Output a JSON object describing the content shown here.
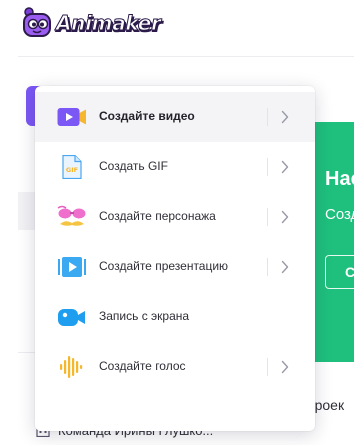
{
  "header": {
    "logo_text": "Animaker"
  },
  "promo": {
    "title": "Нас",
    "subtitle": "Созд",
    "button_label": "С"
  },
  "sidebar": {
    "team_label": "Команда Ирины Глушко..."
  },
  "main": {
    "projects_text": "проек"
  },
  "menu": {
    "items": [
      {
        "label": "Создайте видео",
        "icon": "video-icon",
        "has_submenu": true,
        "active": true
      },
      {
        "label": "Создать GIF",
        "icon": "gif-file-icon",
        "has_submenu": true,
        "active": false
      },
      {
        "label": "Создайте персонажа",
        "icon": "character-icon",
        "has_submenu": true,
        "active": false
      },
      {
        "label": "Создайте презентацию",
        "icon": "presentation-icon",
        "has_submenu": true,
        "active": false
      },
      {
        "label": "Запись с экрана",
        "icon": "camera-icon",
        "has_submenu": false,
        "active": false
      },
      {
        "label": "Создайте голос",
        "icon": "voice-waveform-icon",
        "has_submenu": true,
        "active": false
      }
    ]
  },
  "colors": {
    "brand_purple": "#7b57f5",
    "promo_green": "#1fc07e",
    "active_row": "#f4f4f6"
  }
}
